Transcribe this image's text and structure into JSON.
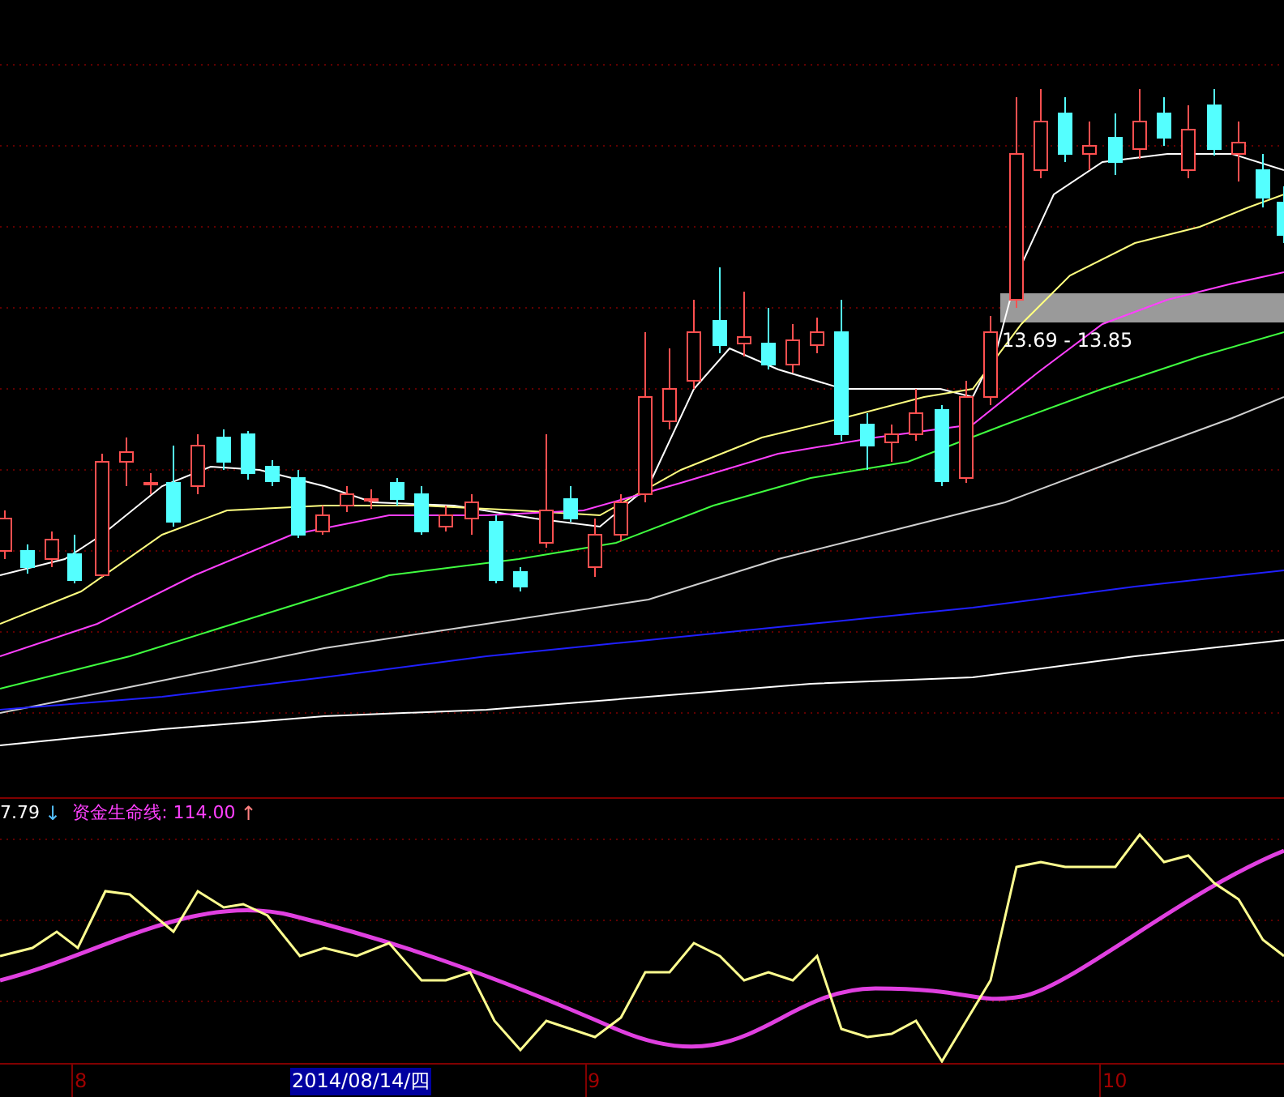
{
  "main_chart": {
    "range_label": "13.69 - 13.85"
  },
  "indicator": {
    "value": "7.79",
    "value_arrow": "↓",
    "line_label": "资金生命线: 114.00",
    "line_arrow": "↑"
  },
  "time_axis": {
    "labels": [
      {
        "text": "8"
      },
      {
        "text": "9"
      },
      {
        "text": "10"
      }
    ],
    "cursor_date": "2014/08/14/四"
  }
}
